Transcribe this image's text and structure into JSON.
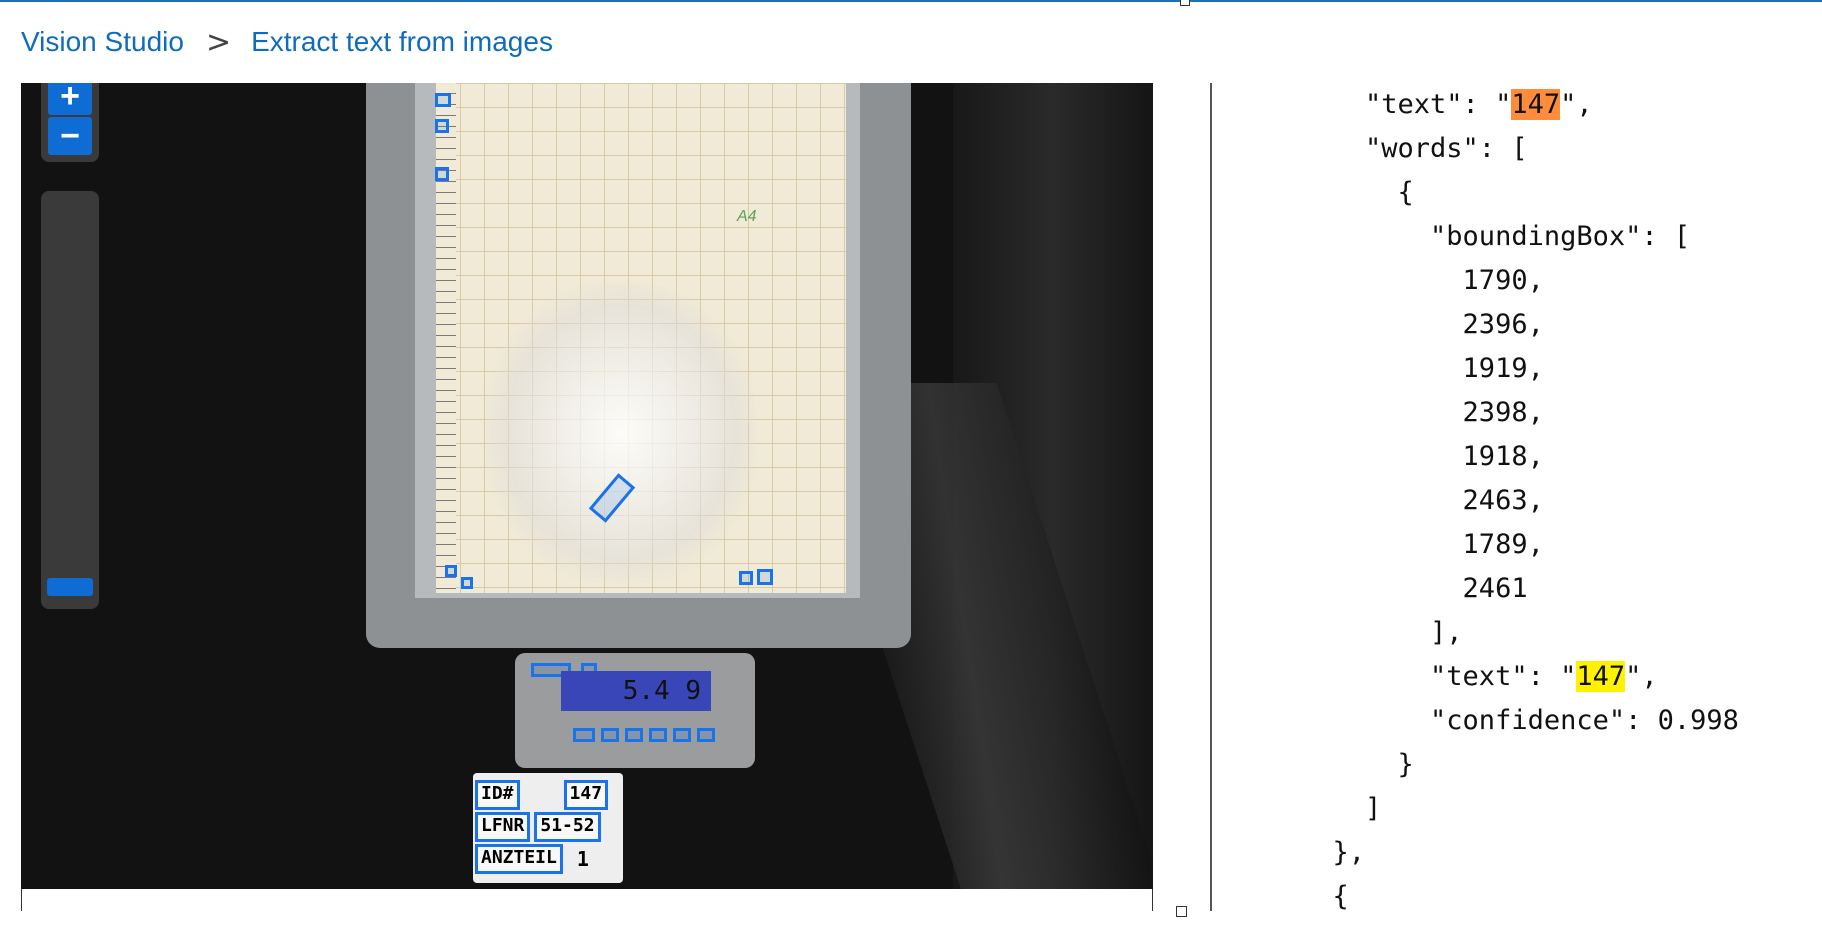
{
  "breadcrumb": {
    "root": "Vision Studio",
    "separator": ">",
    "current": "Extract text from images"
  },
  "viewer": {
    "zoom_in_label": "+",
    "zoom_out_label": "−",
    "zoom_level_fraction": 0.0,
    "scale_display": "5.4 9",
    "label_rows": [
      {
        "key": "ID#",
        "value": "147"
      },
      {
        "key": "LFNR",
        "value": "51-52"
      },
      {
        "key": "ANZTEIL",
        "value": "1"
      }
    ],
    "paper_mark": "A4"
  },
  "json_view": {
    "lines": [
      {
        "indent": "    ",
        "pre": "\"text\": \"",
        "hl": "147",
        "post": "\",",
        "hl_color": "orange"
      },
      {
        "indent": "    ",
        "pre": "\"words\": [",
        "hl": "",
        "post": "",
        "hl_color": ""
      },
      {
        "indent": "      ",
        "pre": "{",
        "hl": "",
        "post": "",
        "hl_color": ""
      },
      {
        "indent": "        ",
        "pre": "\"boundingBox\": [",
        "hl": "",
        "post": "",
        "hl_color": ""
      },
      {
        "indent": "          ",
        "pre": "1790,",
        "hl": "",
        "post": "",
        "hl_color": ""
      },
      {
        "indent": "          ",
        "pre": "2396,",
        "hl": "",
        "post": "",
        "hl_color": ""
      },
      {
        "indent": "          ",
        "pre": "1919,",
        "hl": "",
        "post": "",
        "hl_color": ""
      },
      {
        "indent": "          ",
        "pre": "2398,",
        "hl": "",
        "post": "",
        "hl_color": ""
      },
      {
        "indent": "          ",
        "pre": "1918,",
        "hl": "",
        "post": "",
        "hl_color": ""
      },
      {
        "indent": "          ",
        "pre": "2463,",
        "hl": "",
        "post": "",
        "hl_color": ""
      },
      {
        "indent": "          ",
        "pre": "1789,",
        "hl": "",
        "post": "",
        "hl_color": ""
      },
      {
        "indent": "          ",
        "pre": "2461",
        "hl": "",
        "post": "",
        "hl_color": ""
      },
      {
        "indent": "        ",
        "pre": "],",
        "hl": "",
        "post": "",
        "hl_color": ""
      },
      {
        "indent": "        ",
        "pre": "\"text\": \"",
        "hl": "147",
        "post": "\",",
        "hl_color": "yellow"
      },
      {
        "indent": "        ",
        "pre": "\"confidence\": 0.998",
        "hl": "",
        "post": "",
        "hl_color": ""
      },
      {
        "indent": "      ",
        "pre": "}",
        "hl": "",
        "post": "",
        "hl_color": ""
      },
      {
        "indent": "    ",
        "pre": "]",
        "hl": "",
        "post": "",
        "hl_color": ""
      },
      {
        "indent": "  ",
        "pre": "},",
        "hl": "",
        "post": "",
        "hl_color": ""
      },
      {
        "indent": "  ",
        "pre": "{",
        "hl": "",
        "post": "",
        "hl_color": ""
      }
    ]
  },
  "colors": {
    "link": "#0f6cbd",
    "zoom_button": "#0f6cd4",
    "ocr_box": "#1a73e8",
    "highlight_selected": "#ff8c3a",
    "highlight_match": "#fff200"
  }
}
